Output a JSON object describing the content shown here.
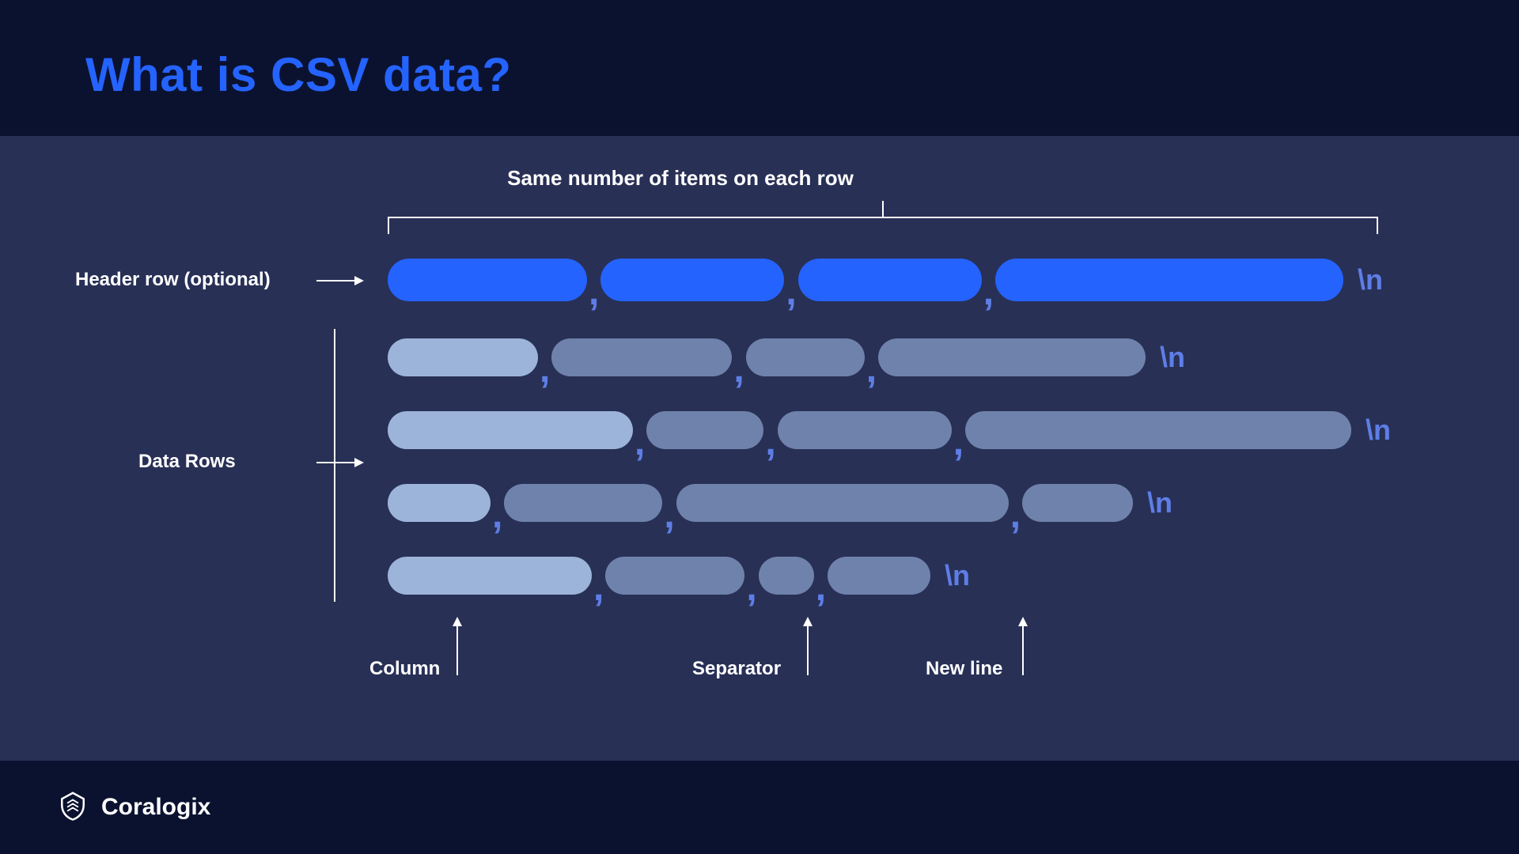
{
  "title": "What is CSV data?",
  "labels": {
    "top_annotation": "Same number of items on each row",
    "header_row": "Header row (optional)",
    "data_rows": "Data Rows",
    "column": "Column",
    "separator": "Separator",
    "newline": "New line"
  },
  "glyphs": {
    "comma": ",",
    "newline": "\\n"
  },
  "brand": "Coralogix"
}
